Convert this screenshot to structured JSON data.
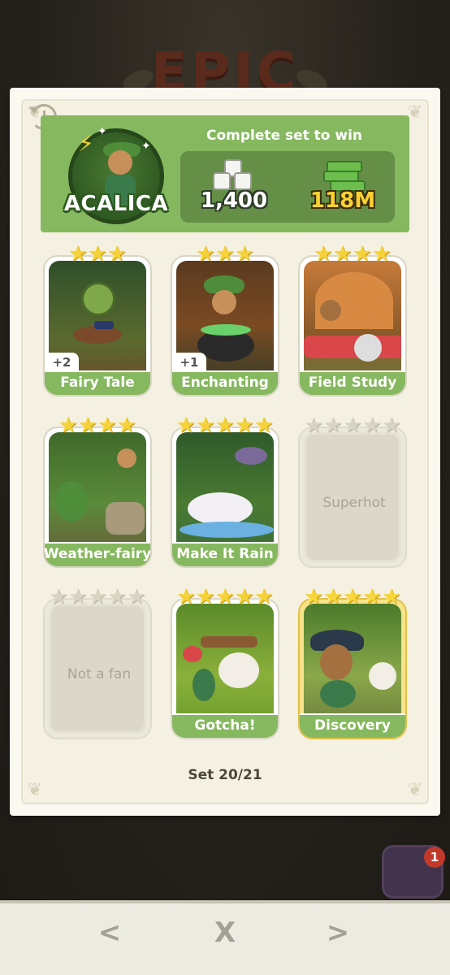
{
  "background": {
    "title": "EPIC"
  },
  "header": {
    "hero_name": "ACALICA",
    "complete_text": "Complete set to win",
    "rewards": {
      "dice": "1,400",
      "cash": "118M"
    },
    "icons": [
      "history-icon",
      "dice-icon",
      "cash-icon"
    ]
  },
  "cards": [
    {
      "name": "Fairy Tale",
      "stars": 3,
      "owned": true,
      "extra": "+2"
    },
    {
      "name": "Enchanting",
      "stars": 3,
      "owned": true,
      "extra": "+1"
    },
    {
      "name": "Field Study",
      "stars": 4,
      "owned": true,
      "extra": ""
    },
    {
      "name": "Weather-fairy",
      "stars": 4,
      "owned": true,
      "extra": ""
    },
    {
      "name": "Make It Rain",
      "stars": 5,
      "owned": true,
      "extra": ""
    },
    {
      "name": "Superhot",
      "stars": 5,
      "owned": false,
      "extra": ""
    },
    {
      "name": "Not a fan",
      "stars": 5,
      "owned": false,
      "extra": ""
    },
    {
      "name": "Gotcha!",
      "stars": 5,
      "owned": true,
      "extra": ""
    },
    {
      "name": "Discovery",
      "stars": 5,
      "owned": true,
      "gold": true,
      "extra": ""
    }
  ],
  "set_progress": "Set 20/21",
  "nav": {
    "prev": "<",
    "close": "X",
    "next": ">"
  },
  "notification_count": "1",
  "colors": {
    "accent_green": "#86b85f",
    "reward_box": "#658f47",
    "cash_gold": "#f9d132"
  }
}
